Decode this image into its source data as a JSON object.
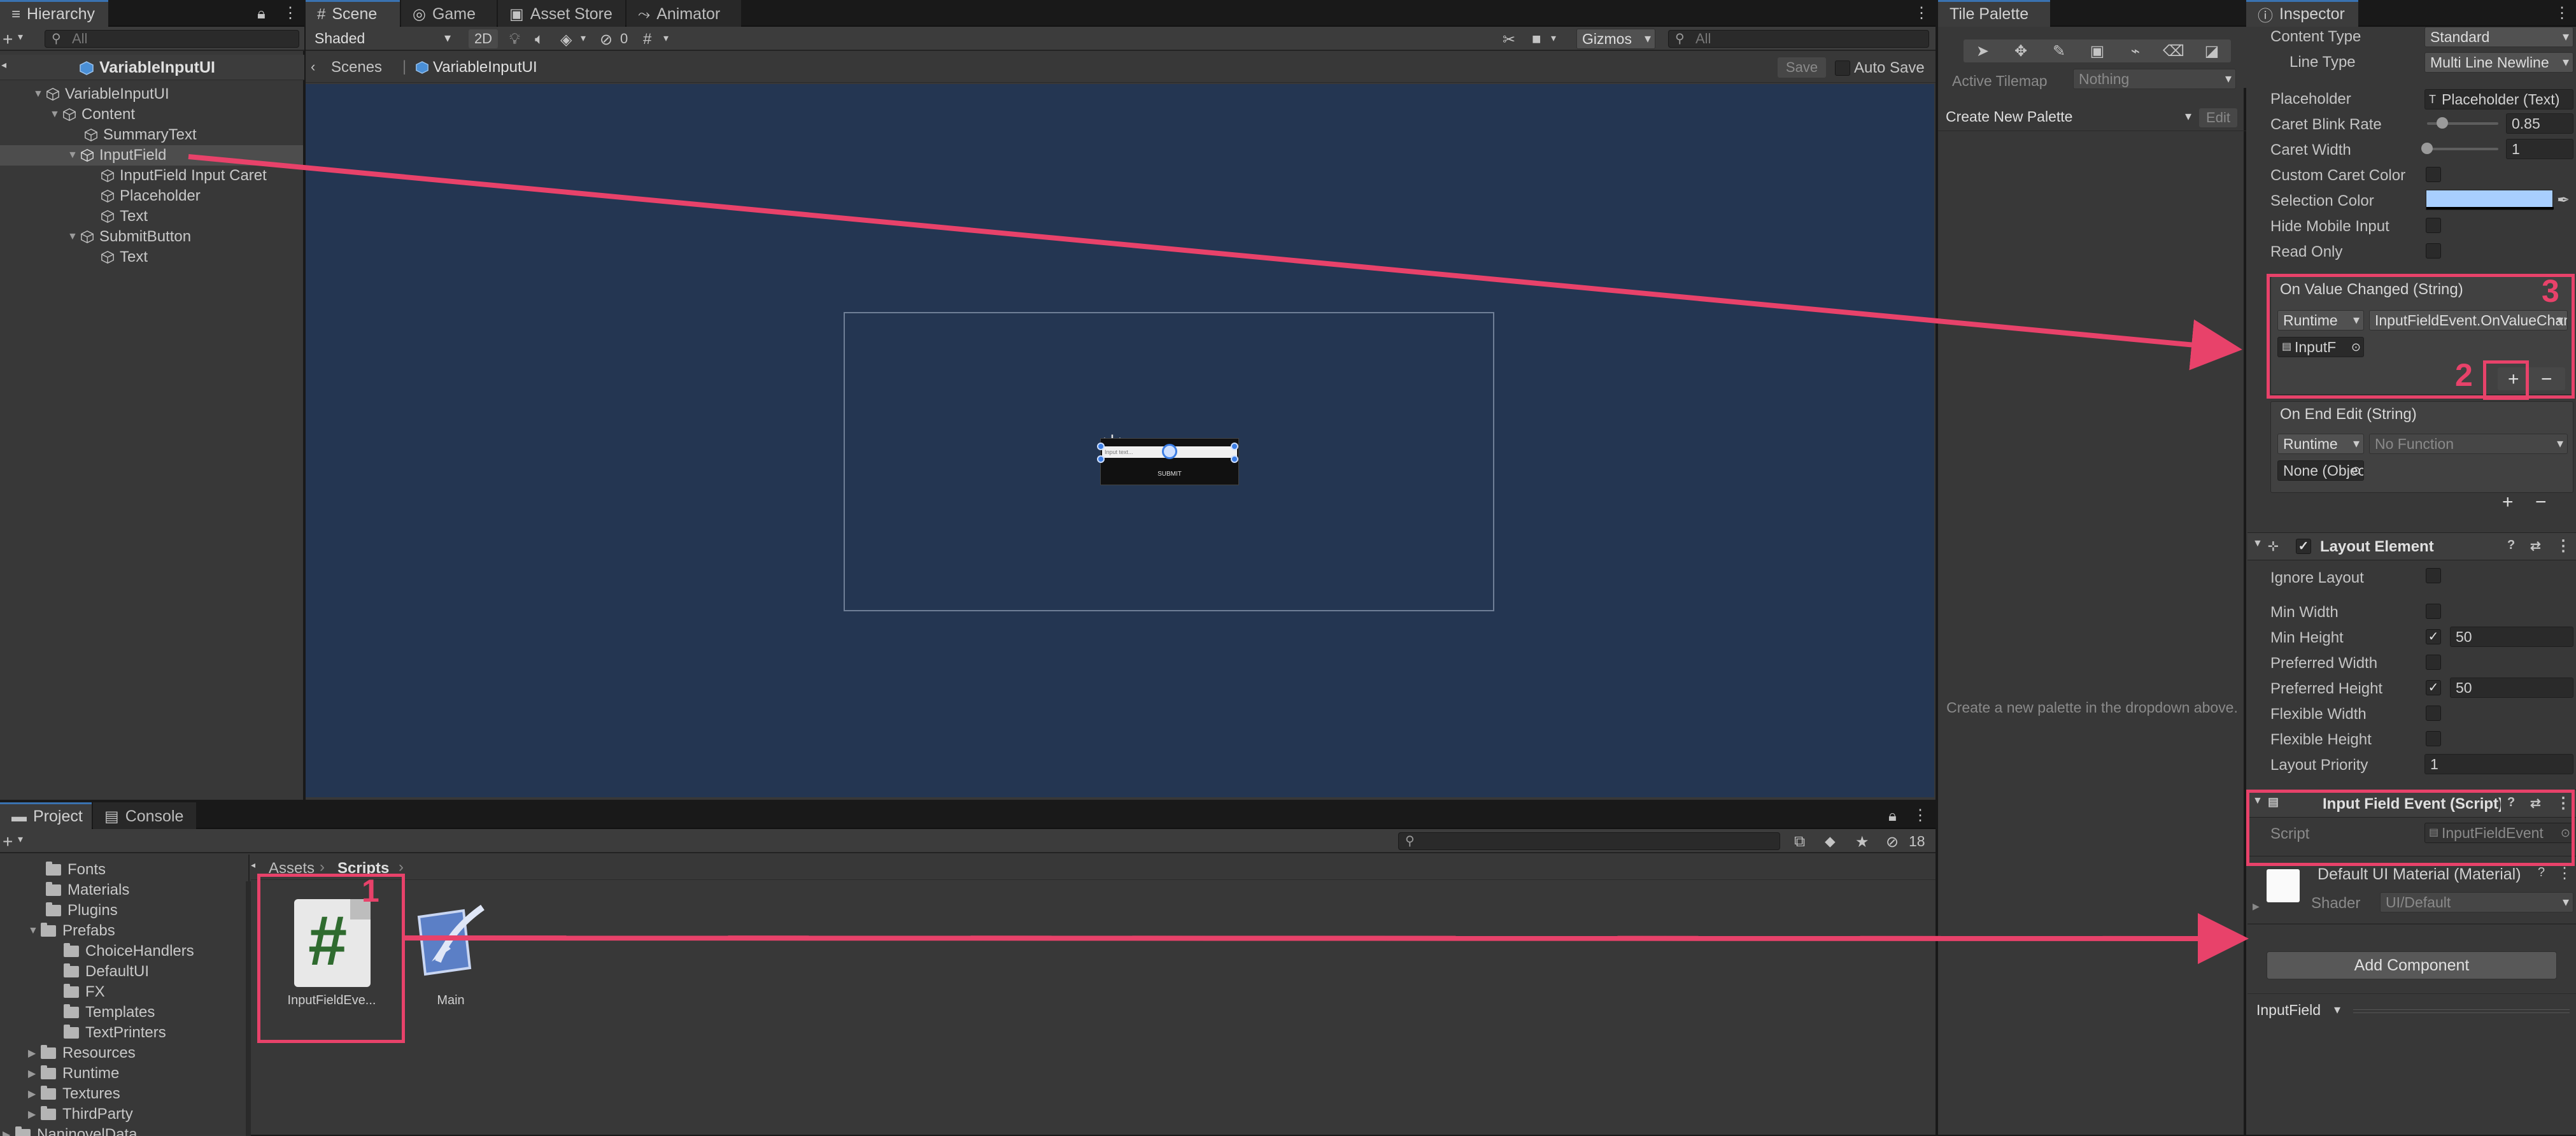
{
  "hierarchy": {
    "tab": "Hierarchy",
    "search_placeholder": "All",
    "scene_root": "VariableInputUI",
    "items": [
      {
        "label": "VariableInputUI"
      },
      {
        "label": "Content"
      },
      {
        "label": "SummaryText"
      },
      {
        "label": "InputField"
      },
      {
        "label": "InputField Input Caret"
      },
      {
        "label": "Placeholder"
      },
      {
        "label": "Text"
      },
      {
        "label": "SubmitButton"
      },
      {
        "label": "Text"
      }
    ]
  },
  "scene": {
    "tabs": [
      "Scene",
      "Game",
      "Asset Store",
      "Animator"
    ],
    "shading": "Shaded",
    "mode_2d": "2D",
    "hidden_count": "0",
    "gizmos": "Gizmos",
    "search_placeholder": "All",
    "breadcrumb": [
      "Scenes",
      "VariableInputUI"
    ],
    "save": "Save",
    "auto_save": "Auto Save",
    "widget_input": "Input text...",
    "widget_button": "SUBMIT"
  },
  "tile_palette": {
    "tab": "Tile Palette",
    "active_tilemap_label": "Active Tilemap",
    "active_tilemap_value": "Nothing",
    "palette_dropdown": "Create New Palette",
    "edit": "Edit",
    "hint": "Create a new palette in the dropdown above."
  },
  "inspector": {
    "tab": "Inspector",
    "content_type_label": "Content Type",
    "content_type_value": "Standard",
    "line_type_label": "Line Type",
    "line_type_value": "Multi Line Newline",
    "placeholder_label": "Placeholder",
    "placeholder_value": "Placeholder (Text)",
    "caret_blink_label": "Caret Blink Rate",
    "caret_blink_value": "0.85",
    "caret_blink_fraction": 0.21,
    "caret_width_label": "Caret Width",
    "caret_width_value": "1",
    "caret_width_fraction": 0.0,
    "custom_caret_label": "Custom Caret Color",
    "selection_color_label": "Selection Color",
    "selection_color": "#a8cefe",
    "hide_mobile_label": "Hide Mobile Input",
    "read_only_label": "Read Only",
    "on_value_changed": "On Value Changed (String)",
    "ovc_runtime": "Runtime",
    "ovc_function": "InputFieldEvent.OnValueChanged",
    "ovc_object": "InputF",
    "on_end_edit": "On End Edit (String)",
    "oee_runtime": "Runtime",
    "oee_function": "No Function",
    "oee_object": "None (Object)",
    "layout_element": "Layout Element",
    "ignore_layout": "Ignore Layout",
    "min_width": "Min Width",
    "min_height": "Min Height",
    "min_height_value": "50",
    "preferred_width": "Preferred Width",
    "preferred_height": "Preferred Height",
    "preferred_height_value": "50",
    "flexible_width": "Flexible Width",
    "flexible_height": "Flexible Height",
    "layout_priority": "Layout Priority",
    "layout_priority_value": "1",
    "ife_title": "Input Field Event (Script)",
    "script_label": "Script",
    "script_value": "InputFieldEvent",
    "material_name": "Default UI Material (Material)",
    "shader_label": "Shader",
    "shader_value": "UI/Default",
    "add_component": "Add Component",
    "footer_dd": "InputField"
  },
  "project": {
    "tabs": [
      "Project",
      "Console"
    ],
    "folders": [
      {
        "label": "Fonts",
        "indent": 1
      },
      {
        "label": "Materials",
        "indent": 1
      },
      {
        "label": "Plugins",
        "indent": 1
      },
      {
        "label": "Prefabs",
        "indent": 1
      },
      {
        "label": "ChoiceHandlers",
        "indent": 2
      },
      {
        "label": "DefaultUI",
        "indent": 2
      },
      {
        "label": "FX",
        "indent": 2
      },
      {
        "label": "Templates",
        "indent": 2
      },
      {
        "label": "TextPrinters",
        "indent": 2
      },
      {
        "label": "Resources",
        "indent": 1
      },
      {
        "label": "Runtime",
        "indent": 1
      },
      {
        "label": "Textures",
        "indent": 1
      },
      {
        "label": "ThirdParty",
        "indent": 1
      },
      {
        "label": "NaninovelData",
        "indent": 0
      }
    ],
    "breadcrumb": [
      "Assets",
      "Scripts"
    ],
    "hidden_count": "18",
    "assets": [
      {
        "label": "InputFieldEve..."
      },
      {
        "label": "Main"
      }
    ]
  },
  "annotations": {
    "n1": "1",
    "n2": "2",
    "n3": "3",
    "color": "#e8426a"
  }
}
